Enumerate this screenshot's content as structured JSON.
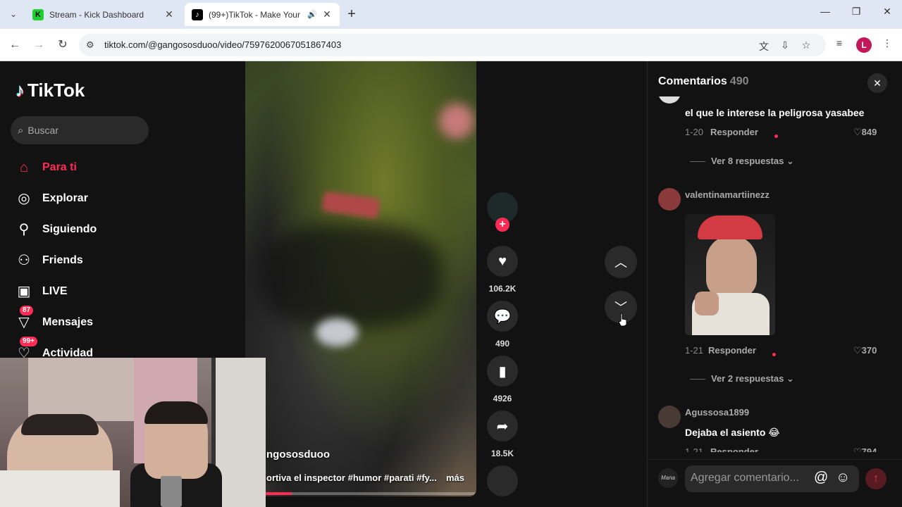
{
  "browser": {
    "tabs": [
      {
        "title": "Stream - Kick Dashboard",
        "favicon": "K",
        "active": false
      },
      {
        "title": "(99+)TikTok - Make Your Da",
        "favicon": "♪",
        "active": true
      }
    ],
    "url": "tiktok.com/@gangososduoo/video/7597620067051867403",
    "profile_initial": "L"
  },
  "sidebar": {
    "logo": "TikTok",
    "search_placeholder": "Buscar",
    "nav": [
      {
        "label": "Para ti",
        "icon": "home-icon"
      },
      {
        "label": "Explorar",
        "icon": "compass-icon"
      },
      {
        "label": "Siguiendo",
        "icon": "following-icon"
      },
      {
        "label": "Friends",
        "icon": "friends-icon"
      },
      {
        "label": "LIVE",
        "icon": "live-icon"
      },
      {
        "label": "Mensajes",
        "icon": "messages-icon",
        "badge": "87"
      },
      {
        "label": "Actividad",
        "icon": "activity-icon",
        "badge": "99+"
      }
    ]
  },
  "video": {
    "username": "ngososduoo",
    "description": "ortiva el inspector #humor #parati #fy...",
    "more_label": "más",
    "progress": 0.2
  },
  "actions": {
    "likes": "106.2K",
    "comments": "490",
    "saves": "4926",
    "shares": "18.5K"
  },
  "comments": {
    "title": "Comentarios",
    "count": "490",
    "reply_label": "Responder",
    "items": [
      {
        "text": "el que le interese la peligrosa yasabee",
        "date": "1-20",
        "likes": "849",
        "more": "Ver 8 respuestas"
      },
      {
        "user": "valentinamartiinezz",
        "date": "1-21",
        "likes": "370",
        "more": "Ver 2 respuestas"
      },
      {
        "user": "Agussosa1899",
        "text": "Dejaba el asiento 😂",
        "date": "1-21",
        "likes": "794"
      }
    ],
    "input_placeholder": "Agregar comentario...",
    "my_avatar": "Mana"
  },
  "colors": {
    "accent": "#fe2c55",
    "bg": "#121212"
  }
}
